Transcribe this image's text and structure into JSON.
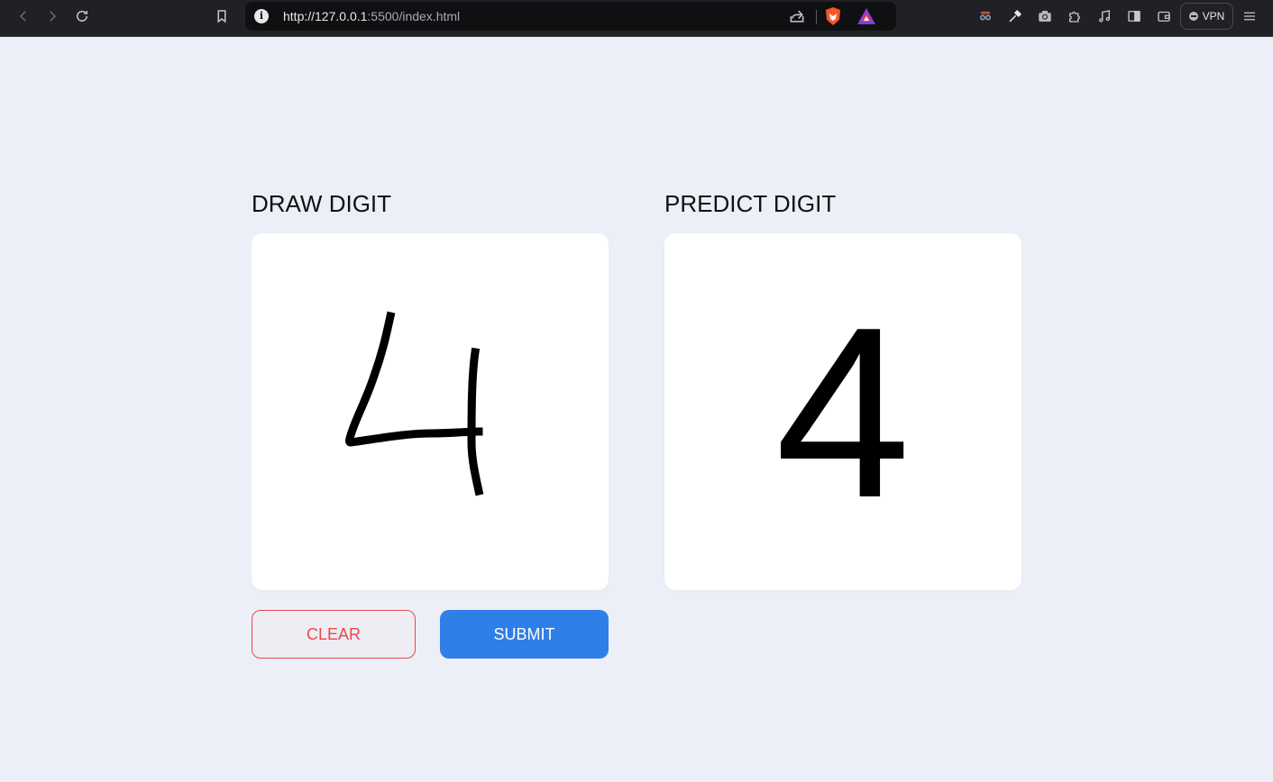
{
  "browser": {
    "url_host": "http://127.0.0.1",
    "url_rest": ":5500/index.html",
    "vpn_label": "VPN"
  },
  "draw": {
    "title": "DRAW DIGIT"
  },
  "predict": {
    "title": "PREDICT DIGIT",
    "value": "4"
  },
  "buttons": {
    "clear": "CLEAR",
    "submit": "SUBMIT"
  },
  "colors": {
    "page_bg": "#eceff7",
    "clear": "#e8494d",
    "submit": "#2f7fe8"
  }
}
